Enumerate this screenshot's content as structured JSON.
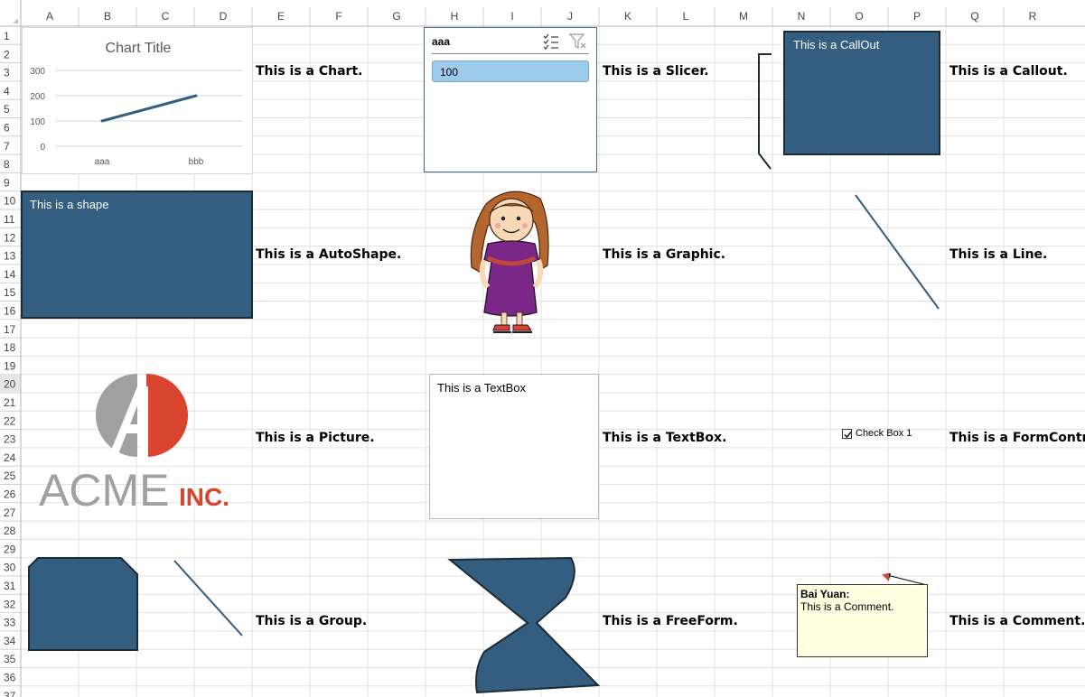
{
  "columns": [
    "A",
    "B",
    "C",
    "D",
    "E",
    "F",
    "G",
    "H",
    "I",
    "J",
    "K",
    "L",
    "M",
    "N",
    "O",
    "P",
    "Q",
    "R"
  ],
  "rows": [
    "1",
    "2",
    "3",
    "4",
    "5",
    "6",
    "7",
    "8",
    "9",
    "10",
    "11",
    "12",
    "13",
    "14",
    "15",
    "16",
    "17",
    "18",
    "19",
    "20",
    "21",
    "22",
    "23",
    "24",
    "25",
    "26",
    "27",
    "28",
    "29",
    "30",
    "31",
    "32",
    "33",
    "34",
    "35",
    "36",
    "37"
  ],
  "selected_row": "20",
  "labels": {
    "chart": "This is a Chart.",
    "slicer": "This is a Slicer.",
    "callout": "This is a Callout.",
    "autoshape": "This is a AutoShape.",
    "graphic": "This is a Graphic.",
    "line": "This is a Line.",
    "picture": "This is a Picture.",
    "textbox": "This is a TextBox.",
    "formcontrol": "This is a FormControl",
    "group": "This is a Group.",
    "freeform": "This is a FreeForm.",
    "comment": "This is a Comment."
  },
  "chart_data": {
    "type": "line",
    "title": "Chart Title",
    "categories": [
      "aaa",
      "bbb"
    ],
    "values": [
      100,
      200
    ],
    "ylim": [
      0,
      300
    ],
    "yticks": [
      0,
      100,
      200,
      300
    ],
    "grid": true,
    "color": "#335e7f"
  },
  "slicer": {
    "title": "aaa",
    "items": [
      "100"
    ],
    "icons": [
      "multi-select-icon",
      "clear-filter-icon"
    ]
  },
  "callout_text": "This is a CallOut",
  "shape_text": "This is a shape",
  "textbox_text": "This is a TextBox",
  "checkbox": {
    "label": "Check Box 1",
    "checked": true
  },
  "comment": {
    "author": "Bai Yuan:",
    "text": "This is a Comment."
  },
  "logo": {
    "main": "ACME",
    "suffix": "INC.",
    "letter": "A"
  },
  "colors": {
    "shape_fill": "#335e7f",
    "accent_red": "#d9442f",
    "logo_gray": "#a0a0a0",
    "grid": "#dadada",
    "header_bg": "#ffffff"
  }
}
